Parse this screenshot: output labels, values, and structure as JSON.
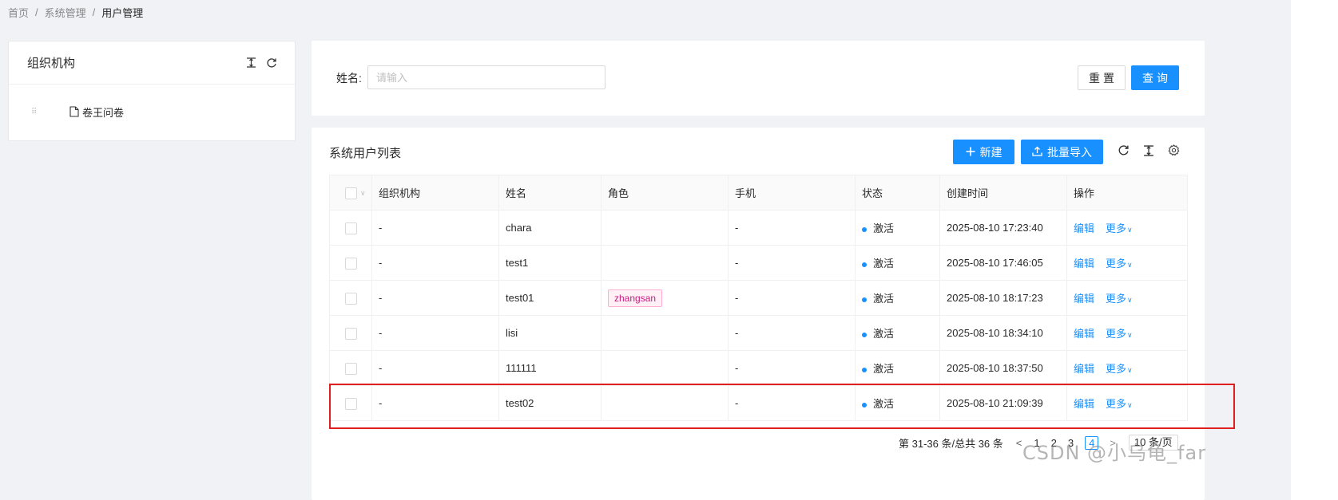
{
  "breadcrumb": {
    "items": [
      "首页",
      "系统管理"
    ],
    "current": "用户管理",
    "separator": "/"
  },
  "tree": {
    "title": "组织机构",
    "node_label": "卷王问卷"
  },
  "search": {
    "label": "姓名:",
    "placeholder": "请输入",
    "reset_label": "重置",
    "query_label": "查询"
  },
  "table": {
    "title": "系统用户列表",
    "new_label": "新建",
    "import_label": "批量导入",
    "columns": [
      "组织机构",
      "姓名",
      "角色",
      "手机",
      "状态",
      "创建时间",
      "操作"
    ],
    "rows": [
      {
        "org": "-",
        "name": "chara",
        "role": "",
        "phone": "-",
        "status": "激活",
        "created": "2025-08-10 17:23:40",
        "edit": "编辑",
        "more": "更多"
      },
      {
        "org": "-",
        "name": "test1",
        "role": "",
        "phone": "-",
        "status": "激活",
        "created": "2025-08-10 17:46:05",
        "edit": "编辑",
        "more": "更多"
      },
      {
        "org": "-",
        "name": "test01",
        "role": "zhangsan",
        "phone": "-",
        "status": "激活",
        "created": "2025-08-10 18:17:23",
        "edit": "编辑",
        "more": "更多"
      },
      {
        "org": "-",
        "name": "lisi",
        "role": "",
        "phone": "-",
        "status": "激活",
        "created": "2025-08-10 18:34:10",
        "edit": "编辑",
        "more": "更多"
      },
      {
        "org": "-",
        "name": "111111",
        "role": "",
        "phone": "-",
        "status": "激活",
        "created": "2025-08-10 18:37:50",
        "edit": "编辑",
        "more": "更多"
      },
      {
        "org": "-",
        "name": "test02",
        "role": "",
        "phone": "-",
        "status": "激活",
        "created": "2025-08-10 21:09:39",
        "edit": "编辑",
        "more": "更多"
      }
    ]
  },
  "pagination": {
    "total_text": "第 31-36 条/总共 36 条",
    "pages": [
      "1",
      "2",
      "3",
      "4"
    ],
    "active_page": "4",
    "page_size": "10 条/页"
  },
  "watermark": "CSDN @小乌龟_far",
  "colors": {
    "primary": "#1890ff",
    "highlight": "#e02020",
    "tag_text": "#c41d7f"
  }
}
